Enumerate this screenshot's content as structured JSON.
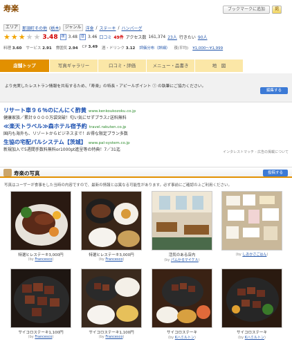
{
  "header": {
    "title": "寿楽",
    "bookmark_label": "ブックマークに追加",
    "share_label": "掲"
  },
  "info": {
    "area_label": "エリア",
    "area_value": "那須町その他",
    "area_pref": "栃木",
    "genre_label": "ジャンル",
    "genres": [
      "洋食",
      "ステーキ",
      "ハンバーグ"
    ]
  },
  "rating": {
    "score": "3.48",
    "stars_on": 3,
    "night_label": "夜",
    "night_score": "3.48",
    "day_label": "昼",
    "day_score": "3.46",
    "reviews_label": "口コミ",
    "reviews_count": "49件",
    "access_label": "アクセス数",
    "access_value": "161,374",
    "people_count": "23人",
    "visit_label": "行きたい",
    "visit_count": "90人"
  },
  "subscores": {
    "ryori_label": "料理",
    "ryori": "3.60",
    "service_label": "サービス",
    "service": "2.91",
    "fun_label": "雰囲気",
    "fun": "2.94",
    "cp_label": "CP",
    "cp": "3.49",
    "drink_label": "酒・ドリンク",
    "drink": "3.12",
    "dist_label": "評価分布（詳細）",
    "price_label": "夜(平均)",
    "price": "¥1,000～¥1,999"
  },
  "tabs": [
    {
      "label": "店舗トップ"
    },
    {
      "label": "写真ギャラリー"
    },
    {
      "label": "口コミ・評価"
    },
    {
      "label": "メニュー・品書き"
    },
    {
      "label": "地　図"
    }
  ],
  "notice": {
    "text": "より充実したレストラン情報を共有するため、「寿楽」の特長・アピールポイント ⓘ の執筆にご協力ください。",
    "edit_label": "編集する"
  },
  "ads": [
    {
      "title": "リサート車９６％のにんにく酢黄",
      "url": "www.kenkoukozoku.co.jp",
      "desc": "健康家族／累計９０００万袋突破！匂い気にせずプラス♪送料無料"
    },
    {
      "title": "≪楽天トラベル≫森ホテル宿予約",
      "url": "travel.rakuten.co.jp",
      "desc": "国内も海外も、リゾートからビジネスまで！お得な限定プラン多数"
    },
    {
      "title": "生協の宅配パルシステム【茨城】",
      "url": "www.pal-system.co.jp",
      "desc": "新規加入で5週間手数料無料or1000pt進呈等の特典！7／31迄"
    }
  ],
  "ads_footer": "インタレストマッチ - 広告の掲載について",
  "photo_section": {
    "title": "寿楽の写真",
    "post_label": "投稿する",
    "note": "写真はユーザーが食事をした当時の内容ですので、最新の情報とは異なる可能性があります。必ず事前にご確認の上ご利用ください。"
  },
  "photos": [
    {
      "caption": "特選ヒレステーキ3,000円",
      "by": "Francesco"
    },
    {
      "caption": "特選ヒレステーキ3,000円",
      "by": "Francesco"
    },
    {
      "caption": "活気のある店内",
      "by": "パムかるマイケル"
    },
    {
      "caption": "",
      "by": "しおかさごはん"
    },
    {
      "caption": "サイコロステーキ1,100円",
      "by": "Francesco"
    },
    {
      "caption": "サイコロステーキ1,100円",
      "by": "Francesco"
    },
    {
      "caption": "サイコロステーキ",
      "by": "Kハミルトン"
    },
    {
      "caption": "サイコロステーキ",
      "by": "Kハミルトン"
    }
  ],
  "by_prefix": "(by",
  "by_suffix": ")"
}
